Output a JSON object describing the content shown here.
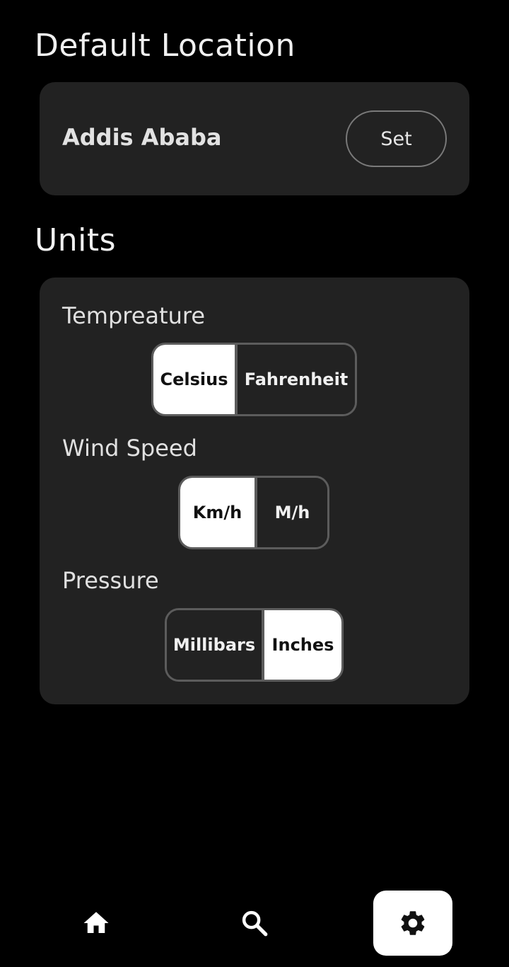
{
  "default_location": {
    "title": "Default Location",
    "city": "Addis Ababa",
    "set_label": "Set"
  },
  "units": {
    "title": "Units",
    "temperature": {
      "label": "Tempreature",
      "options": [
        "Celsius",
        "Fahrenheit"
      ],
      "selected": "Celsius"
    },
    "wind_speed": {
      "label": "Wind Speed",
      "options": [
        "Km/h",
        "M/h"
      ],
      "selected": "Km/h"
    },
    "pressure": {
      "label": "Pressure",
      "options": [
        "Millibars",
        "Inches"
      ],
      "selected": "Inches"
    }
  },
  "bottom_nav": {
    "items": [
      {
        "icon": "home-icon",
        "active": false
      },
      {
        "icon": "search-icon",
        "active": false
      },
      {
        "icon": "gear-icon",
        "active": true
      }
    ]
  },
  "colors": {
    "background": "#000000",
    "card": "#222222",
    "selected": "#ffffff",
    "border": "#5c5c5c"
  }
}
